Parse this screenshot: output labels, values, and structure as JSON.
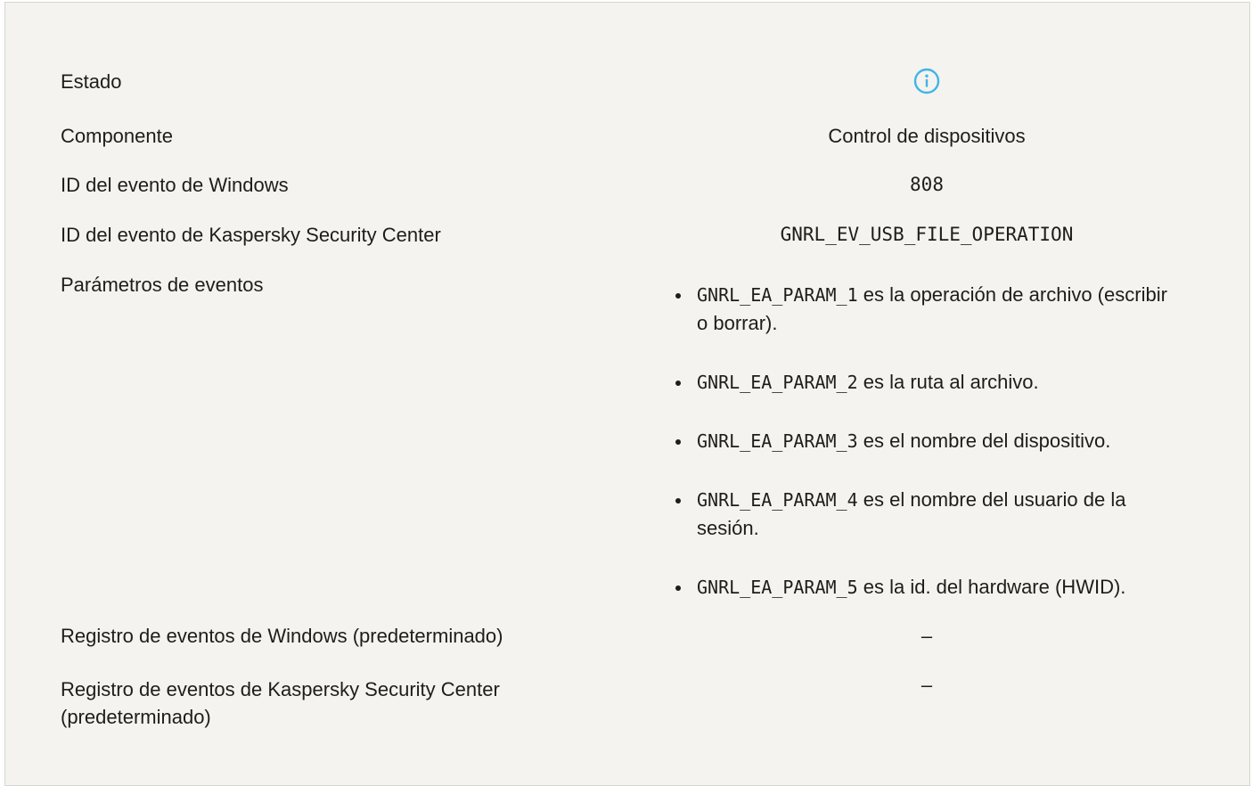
{
  "rows": {
    "estado": {
      "label": "Estado",
      "icon": "info-icon",
      "icon_color": "#3fb5e6"
    },
    "componente": {
      "label": "Componente",
      "value": "Control de dispositivos"
    },
    "win_event_id": {
      "label": "ID del evento de Windows",
      "value": "808"
    },
    "ksc_event_id": {
      "label": "ID del evento de Kaspersky Security Center",
      "value": "GNRL_EV_USB_FILE_OPERATION"
    },
    "params": {
      "label": "Parámetros de eventos",
      "items": [
        {
          "code": "GNRL_EA_PARAM_1",
          "text": "es la operación de archivo (escribir o borrar)."
        },
        {
          "code": "GNRL_EA_PARAM_2",
          "text": "es la ruta al archivo."
        },
        {
          "code": "GNRL_EA_PARAM_3",
          "text": "es el nombre del dispositivo."
        },
        {
          "code": "GNRL_EA_PARAM_4",
          "text": "es el nombre del usuario de la sesión."
        },
        {
          "code": "GNRL_EA_PARAM_5",
          "text": "es la id. del hardware (HWID)."
        }
      ]
    },
    "win_log": {
      "label": "Registro de eventos de Windows (predeterminado)",
      "value": "–"
    },
    "ksc_log": {
      "label": "Registro de eventos de Kaspersky Security Center (predeterminado)",
      "value": "–"
    }
  }
}
